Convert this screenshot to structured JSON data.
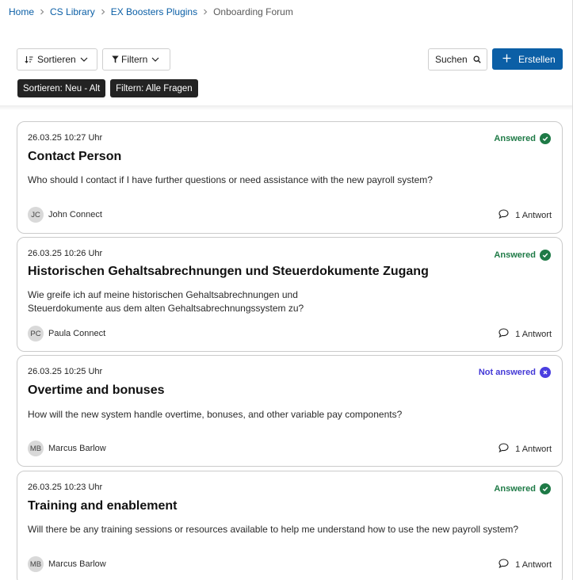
{
  "breadcrumb": {
    "items": [
      "Home",
      "CS Library",
      "EX Boosters Plugins"
    ],
    "current": "Onboarding Forum"
  },
  "toolbar": {
    "sort_label": "Sortieren",
    "filter_label": "Filtern",
    "search_label": "Suchen",
    "create_label": "Erstellen"
  },
  "active_chips": [
    "Sortieren: Neu - Alt",
    "Filtern: Alle Fragen"
  ],
  "colors": {
    "primary": "#0b5fa6",
    "answered": "#1e7a46",
    "not_answered": "#4a3fe0",
    "chip_bg": "#232323"
  },
  "posts": [
    {
      "date": "26.03.25 10:27 Uhr",
      "status": "Answered",
      "title": "Contact Person",
      "body": "Who should I contact if I have further questions or need assistance with the new payroll system?",
      "author_initials": "JC",
      "author": "John Connect",
      "replies": "1 Antwort"
    },
    {
      "date": "26.03.25 10:26 Uhr",
      "status": "Answered",
      "title": "Historischen Gehaltsabrechnungen und Steuerdokumente Zugang",
      "body": "Wie greife ich auf meine historischen Gehaltsabrechnungen und Steuerdokumente aus dem alten Gehaltsabrechnungssystem zu?",
      "author_initials": "PC",
      "author": "Paula Connect",
      "replies": "1 Antwort"
    },
    {
      "date": "26.03.25 10:25 Uhr",
      "status": "Not answered",
      "title": "Overtime and bonuses",
      "body": "How will the new system handle overtime, bonuses, and other variable pay components?",
      "author_initials": "MB",
      "author": "Marcus Barlow",
      "replies": "1 Antwort"
    },
    {
      "date": "26.03.25 10:23 Uhr",
      "status": "Answered",
      "title": "Training and enablement",
      "body": "Will there be any training sessions or resources available to help me understand how to use the new payroll system?",
      "author_initials": "MB",
      "author": "Marcus Barlow",
      "replies": "1 Antwort"
    }
  ]
}
